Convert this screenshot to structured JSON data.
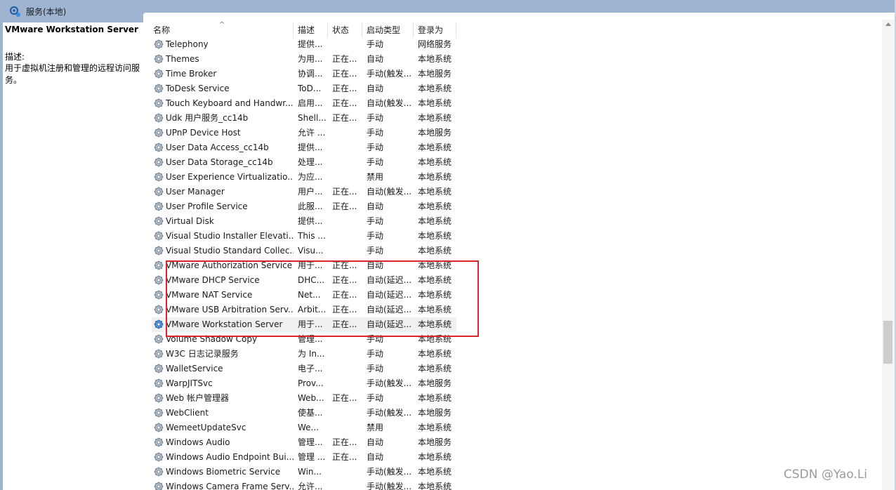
{
  "window": {
    "title": "服务(本地)"
  },
  "left_panel": {
    "selected_service": "VMware Workstation Server",
    "desc_label": "描述:",
    "desc_text": "用于虚拟机注册和管理的远程访问服务。"
  },
  "columns": {
    "name": "名称",
    "desc": "描述",
    "status": "状态",
    "startup": "启动类型",
    "logon": "登录为"
  },
  "rows": [
    {
      "name": "Telephony",
      "desc": "提供...",
      "status": "",
      "startup": "手动",
      "logon": "网络服务"
    },
    {
      "name": "Themes",
      "desc": "为用...",
      "status": "正在...",
      "startup": "自动",
      "logon": "本地系统"
    },
    {
      "name": "Time Broker",
      "desc": "协调...",
      "status": "正在...",
      "startup": "手动(触发...",
      "logon": "本地服务"
    },
    {
      "name": "ToDesk Service",
      "desc": "ToD...",
      "status": "正在...",
      "startup": "自动",
      "logon": "本地系统"
    },
    {
      "name": "Touch Keyboard and Handwr...",
      "desc": "启用...",
      "status": "正在...",
      "startup": "自动(触发...",
      "logon": "本地系统"
    },
    {
      "name": "Udk 用户服务_cc14b",
      "desc": "Shell...",
      "status": "正在...",
      "startup": "手动",
      "logon": "本地系统"
    },
    {
      "name": "UPnP Device Host",
      "desc": "允许 ...",
      "status": "",
      "startup": "手动",
      "logon": "本地服务"
    },
    {
      "name": "User Data Access_cc14b",
      "desc": "提供...",
      "status": "",
      "startup": "手动",
      "logon": "本地系统"
    },
    {
      "name": "User Data Storage_cc14b",
      "desc": "处理...",
      "status": "",
      "startup": "手动",
      "logon": "本地系统"
    },
    {
      "name": "User Experience Virtualizatio...",
      "desc": "为应...",
      "status": "",
      "startup": "禁用",
      "logon": "本地系统"
    },
    {
      "name": "User Manager",
      "desc": "用户...",
      "status": "正在...",
      "startup": "自动(触发...",
      "logon": "本地系统"
    },
    {
      "name": "User Profile Service",
      "desc": "此服...",
      "status": "正在...",
      "startup": "自动",
      "logon": "本地系统"
    },
    {
      "name": "Virtual Disk",
      "desc": "提供...",
      "status": "",
      "startup": "手动",
      "logon": "本地系统"
    },
    {
      "name": "Visual Studio Installer Elevati...",
      "desc": "This ...",
      "status": "",
      "startup": "手动",
      "logon": "本地系统"
    },
    {
      "name": "Visual Studio Standard Collec...",
      "desc": "Visu...",
      "status": "",
      "startup": "手动",
      "logon": "本地系统"
    },
    {
      "name": "VMware Authorization Service",
      "desc": "用于...",
      "status": "正在...",
      "startup": "自动",
      "logon": "本地系统"
    },
    {
      "name": "VMware DHCP Service",
      "desc": "DHC...",
      "status": "正在...",
      "startup": "自动(延迟...",
      "logon": "本地系统"
    },
    {
      "name": "VMware NAT Service",
      "desc": "Net...",
      "status": "正在...",
      "startup": "自动(延迟...",
      "logon": "本地系统"
    },
    {
      "name": "VMware USB Arbitration Serv...",
      "desc": "Arbit...",
      "status": "正在...",
      "startup": "自动(延迟...",
      "logon": "本地系统"
    },
    {
      "name": "VMware Workstation Server",
      "desc": "用于...",
      "status": "正在...",
      "startup": "自动(延迟...",
      "logon": "本地系统"
    },
    {
      "name": "Volume Shadow Copy",
      "desc": "管理...",
      "status": "",
      "startup": "手动",
      "logon": "本地系统"
    },
    {
      "name": "W3C 日志记录服务",
      "desc": "为 In...",
      "status": "",
      "startup": "手动",
      "logon": "本地系统"
    },
    {
      "name": "WalletService",
      "desc": "电子...",
      "status": "",
      "startup": "手动",
      "logon": "本地系统"
    },
    {
      "name": "WarpJITSvc",
      "desc": "Prov...",
      "status": "",
      "startup": "手动(触发...",
      "logon": "本地服务"
    },
    {
      "name": "Web 帐户管理器",
      "desc": "Web...",
      "status": "正在...",
      "startup": "手动",
      "logon": "本地系统"
    },
    {
      "name": "WebClient",
      "desc": "使基...",
      "status": "",
      "startup": "手动(触发...",
      "logon": "本地服务"
    },
    {
      "name": "WemeetUpdateSvc",
      "desc": "We...",
      "status": "",
      "startup": "禁用",
      "logon": "本地系统"
    },
    {
      "name": "Windows Audio",
      "desc": "管理...",
      "status": "正在...",
      "startup": "自动",
      "logon": "本地服务"
    },
    {
      "name": "Windows Audio Endpoint Bui...",
      "desc": "管理 ...",
      "status": "正在...",
      "startup": "自动",
      "logon": "本地系统"
    },
    {
      "name": "Windows Biometric Service",
      "desc": "Win...",
      "status": "",
      "startup": "手动(触发...",
      "logon": "本地系统"
    },
    {
      "name": "Windows Camera Frame Serv...",
      "desc": "允许...",
      "status": "",
      "startup": "手动(触发...",
      "logon": "本地系统"
    }
  ],
  "selected_index": 19,
  "watermark": "CSDN @Yao.Li",
  "colors": {
    "highlight": "#d9262b",
    "selected_row": "#f0f0f0",
    "title_bar": "#9fb4d0"
  },
  "icons": {
    "title": "services-gear-icon",
    "row": "service-gear-icon"
  }
}
